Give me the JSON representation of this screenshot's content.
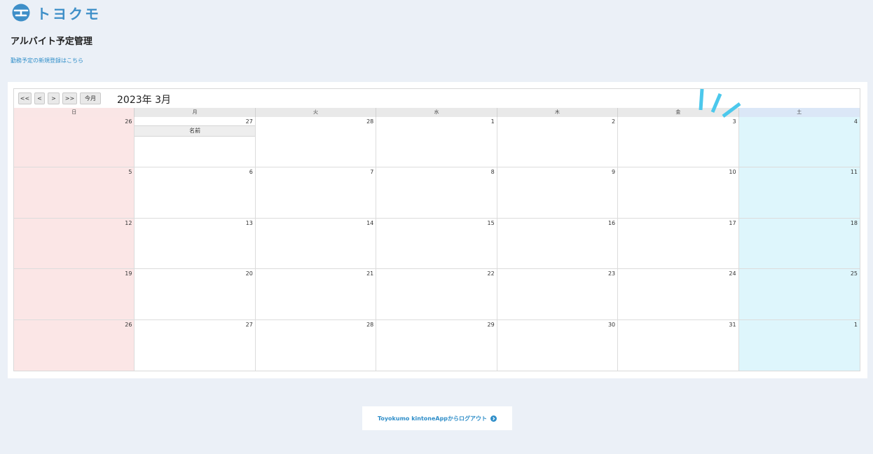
{
  "header": {
    "logo_text": "トヨクモ",
    "page_title": "アルバイト予定管理",
    "register_link": "勤務予定の新規登録はこちら"
  },
  "calendar": {
    "title": "2023年 3月",
    "buttons": {
      "prev_year": "<<",
      "prev_month": "<",
      "next_month": ">",
      "next_year": ">>",
      "today": "今月"
    },
    "weekdays": [
      "日",
      "月",
      "火",
      "水",
      "木",
      "金",
      "土"
    ],
    "weeks": [
      [
        "26",
        "27",
        "28",
        "1",
        "2",
        "3",
        "4"
      ],
      [
        "5",
        "6",
        "7",
        "8",
        "9",
        "10",
        "11"
      ],
      [
        "12",
        "13",
        "14",
        "15",
        "16",
        "17",
        "18"
      ],
      [
        "19",
        "20",
        "21",
        "22",
        "23",
        "24",
        "25"
      ],
      [
        "26",
        "27",
        "28",
        "29",
        "30",
        "31",
        "1"
      ]
    ],
    "event": {
      "week": 0,
      "day": 1,
      "label": "名前"
    }
  },
  "footer": {
    "logout_label": "Toyokumo kintoneAppからログアウト"
  },
  "colors": {
    "background": "#ebf0f7",
    "accent": "#2f8ec9",
    "sunday": "#fbe6e6",
    "saturday": "#def6fc",
    "decoration": "#4cc8ec"
  },
  "icons": {
    "logo": "toyokumo-logo-icon",
    "logout": "chevron-right-circle-icon"
  }
}
